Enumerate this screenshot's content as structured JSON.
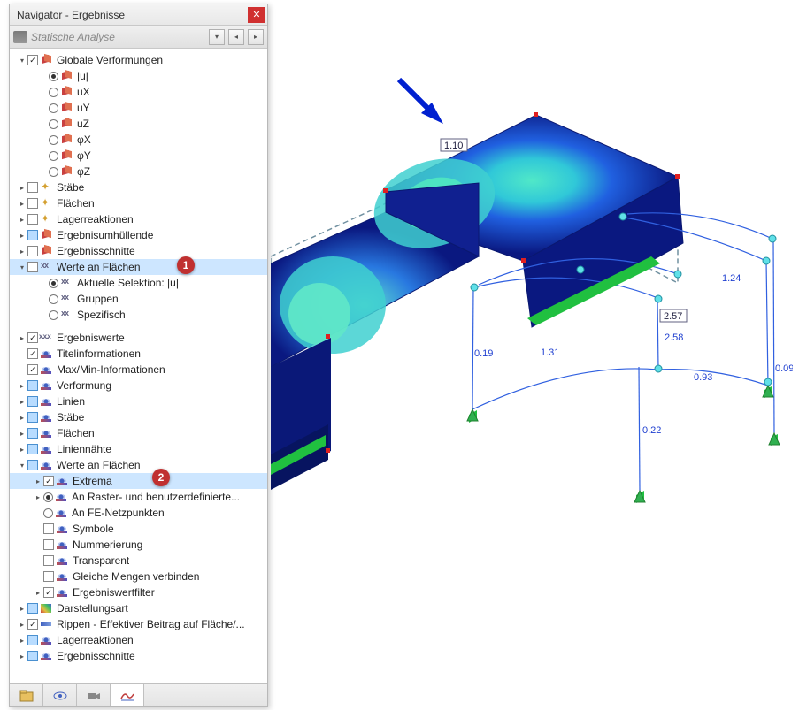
{
  "window": {
    "title": "Navigator - Ergebnisse"
  },
  "toolbar": {
    "analysis_label": "Statische Analyse"
  },
  "tree": {
    "globale_verformungen": "Globale Verformungen",
    "u_abs": "|u|",
    "ux": "uX",
    "uy": "uY",
    "uz": "uZ",
    "phix": "φX",
    "phiy": "φY",
    "phiz": "φZ",
    "staebe": "Stäbe",
    "flaechen": "Flächen",
    "lagerreaktionen": "Lagerreaktionen",
    "ergebnisumhuellende": "Ergebnisumhüllende",
    "ergebnisschnitte": "Ergebnisschnitte",
    "werte_an_flaechen": "Werte an Flächen",
    "aktuelle_selektion": "Aktuelle Selektion: |u|",
    "gruppen": "Gruppen",
    "spezifisch": "Spezifisch",
    "ergebniswerte": "Ergebniswerte",
    "titelinformationen": "Titelinformationen",
    "maxmin_info": "Max/Min-Informationen",
    "verformung": "Verformung",
    "linien": "Linien",
    "staebe2": "Stäbe",
    "flaechen2": "Flächen",
    "liniennaehte": "Liniennähte",
    "werte_an_flaechen2": "Werte an Flächen",
    "extrema": "Extrema",
    "an_raster": "An Raster- und benutzerdefinierte...",
    "an_fe": "An FE-Netzpunkten",
    "symbole": "Symbole",
    "nummerierung": "Nummerierung",
    "transparent": "Transparent",
    "gleiche_mengen": "Gleiche Mengen verbinden",
    "ergebniswertfilter": "Ergebniswertfilter",
    "darstellungsart": "Darstellungsart",
    "rippen": "Rippen - Effektiver Beitrag auf Fläche/...",
    "lagerreaktionen2": "Lagerreaktionen",
    "ergebnisschnitte2": "Ergebnisschnitte"
  },
  "badges": {
    "b1": "1",
    "b2": "2"
  },
  "viewport": {
    "labels": {
      "v110": "1.10",
      "v124": "1.24",
      "v257": "2.57",
      "v258": "2.58",
      "v019": "0.19",
      "v131": "1.31",
      "v093": "0.93",
      "v009": "0.09",
      "v022": "0.22"
    }
  }
}
